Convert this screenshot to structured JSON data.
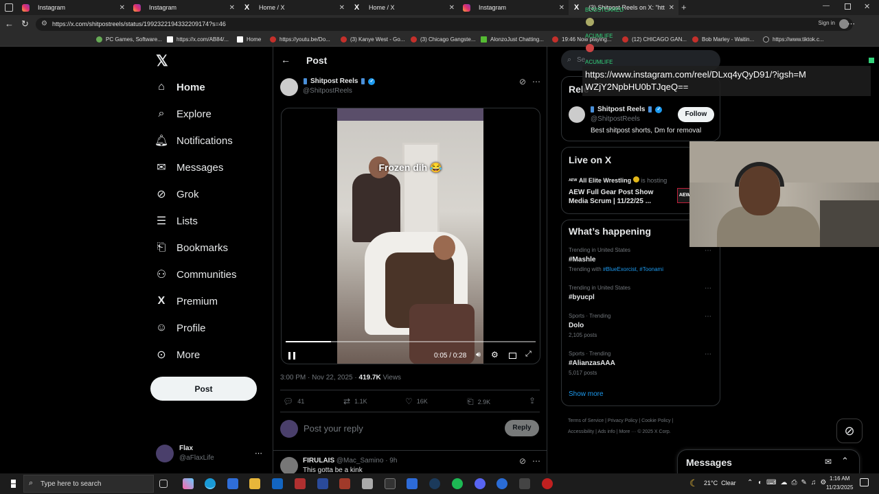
{
  "tabs": [
    {
      "title": "Instagram",
      "icon": "instagram-icon"
    },
    {
      "title": "Instagram",
      "icon": "instagram-icon"
    },
    {
      "title": "Home / X",
      "icon": "x-logo-icon"
    },
    {
      "title": "Home / X",
      "icon": "x-logo-icon"
    },
    {
      "title": "Instagram",
      "icon": "instagram-icon"
    },
    {
      "title": "(3) Shitpost Reels on X: \"htt",
      "icon": "x-logo-icon"
    }
  ],
  "address": {
    "url": "https://x.com/shitpostreels/status/1992322194332209174?s=46",
    "signin": "Sign in"
  },
  "bookmarks": [
    "PC Games, Software...",
    "https://x.com/AB84/...",
    "Home",
    "https://youtu.be/Do...",
    "(3) Kanye West - Go...",
    "(3) Chicago Gangste...",
    "AlonzoJust Chatting...",
    "19:46 Now playing...",
    "(12) CHICAGO GAN...",
    "Bob Marley - Waitin...",
    "https://www.tiktok.c..."
  ],
  "nav": {
    "items": [
      "Home",
      "Explore",
      "Notifications",
      "Messages",
      "Grok",
      "Lists",
      "Bookmarks",
      "Communities",
      "Premium",
      "Profile",
      "More"
    ],
    "post_label": "Post",
    "account_name": "Flax",
    "account_handle": "@aFlaxLife"
  },
  "post": {
    "header": "Post",
    "author_name": "Shitpost Reels",
    "author_handle": "@ShitpostReels",
    "video_caption": "Frozen dih 😂",
    "video_time": "0:05 / 0:28",
    "video_progress": 0.18,
    "timestamp": "3:00 PM · Nov 22, 2025 · ",
    "views_count": "419.7K",
    "views_label": " Views",
    "replies": "41",
    "reposts": "1.1K",
    "likes": "16K",
    "bookmarks": "2.9K",
    "reply_placeholder": "Post your reply",
    "reply_button": "Reply"
  },
  "reply": {
    "name": "FIRULAIS",
    "handle": "@Mac_Samino",
    "time": "· 9h",
    "text": "This gotta be a kink"
  },
  "right": {
    "search_placeholder": "Se",
    "relevant_title": "Rele",
    "profile_name": "Shitpost Reels",
    "profile_handle": "@ShitpostReels",
    "profile_bio": "Best shitpost shorts, Dm for removal",
    "follow_label": "Follow",
    "live_title": "Live on X",
    "live_host": "All Elite Wrestling",
    "live_hosting": "is hosting",
    "live_event": "AEW Full Gear Post Show Media Scrum | 11/22/25 ...",
    "live_badge": "AEW",
    "happening_title": "What’s happening",
    "trends": [
      {
        "category": "Trending in United States",
        "name": "#Mashle",
        "sub_prefix": "Trending with ",
        "sub_links": "#BlueExorcist, #Toonami",
        "sub": ""
      },
      {
        "category": "Trending in United States",
        "name": "#byucpl",
        "sub_prefix": "",
        "sub_links": "",
        "sub": ""
      },
      {
        "category": "Sports · Trending",
        "name": "Dolo",
        "sub_prefix": "",
        "sub_links": "",
        "sub": "2,105 posts"
      },
      {
        "category": "Sports · Trending",
        "name": "#AlianzasAAA",
        "sub_prefix": "",
        "sub_links": "",
        "sub": "5,017 posts"
      }
    ],
    "show_more": "Show more",
    "footer": [
      "Terms of Service",
      "Privacy Policy",
      "Cookie Policy",
      "Accessibility",
      "Ads info",
      "More ···",
      "© 2025 X Corp."
    ],
    "messages_title": "Messages"
  },
  "overlay": {
    "badge1": "BOOSTCARED",
    "badge2": "ACUMLIFE",
    "badge3": "ACUMLIFE",
    "chat_text": "https://www.instagram.com/reel/DLxq4yQyD91/?igsh=MWZjY2NpbHU0bTJqeQ=="
  },
  "taskbar": {
    "search_placeholder": "Type here to search",
    "weather": "21°C  Clear",
    "time": "1:16 AM",
    "date": "11/23/2025"
  },
  "colors": {
    "accent": "#1d9bf0",
    "background": "#000000",
    "border": "#2f3336"
  }
}
